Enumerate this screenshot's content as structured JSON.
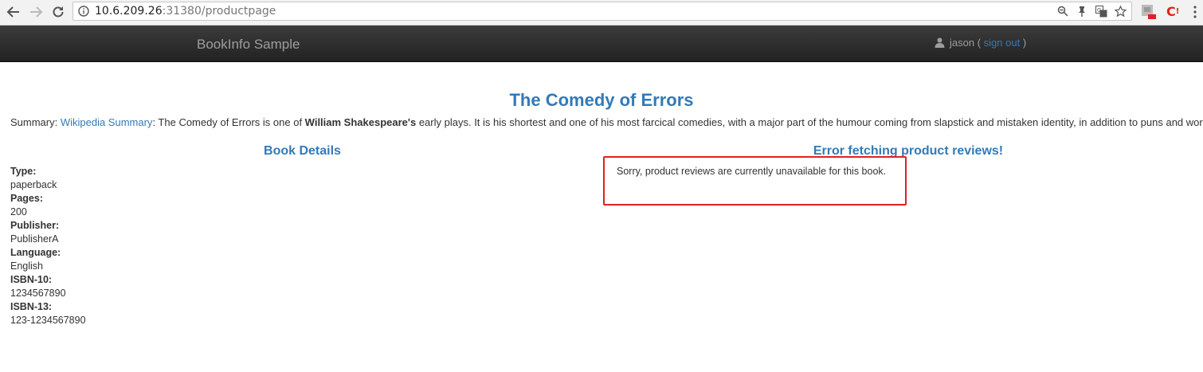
{
  "browser": {
    "url_host": "10.6.209.26",
    "url_rest": ":31380/productpage"
  },
  "navbar": {
    "brand": "BookInfo Sample",
    "user_name": "jason",
    "open_paren": "(",
    "sign_out": "sign out",
    "close_paren": ")"
  },
  "product": {
    "title": "The Comedy of Errors",
    "summary_label": "Summary: ",
    "summary_link": "Wikipedia Summary",
    "summary_text_1": ": The Comedy of Errors is one of ",
    "summary_author": "William Shakespeare's",
    "summary_text_2": " early plays. It is his shortest and one of his most farcical comedies, with a major part of the humour coming from slapstick and mistaken identity, in addition to puns and word play."
  },
  "details": {
    "heading": "Book Details",
    "items": [
      {
        "label": "Type:",
        "value": "paperback"
      },
      {
        "label": "Pages:",
        "value": "200"
      },
      {
        "label": "Publisher:",
        "value": "PublisherA"
      },
      {
        "label": "Language:",
        "value": "English"
      },
      {
        "label": "ISBN-10:",
        "value": "1234567890"
      },
      {
        "label": "ISBN-13:",
        "value": "123-1234567890"
      }
    ]
  },
  "reviews": {
    "heading": "Error fetching product reviews!",
    "message": "Sorry, product reviews are currently unavailable for this book."
  },
  "colors": {
    "link": "#337ab7",
    "navbar": "#222222",
    "highlight": "#e02020"
  }
}
